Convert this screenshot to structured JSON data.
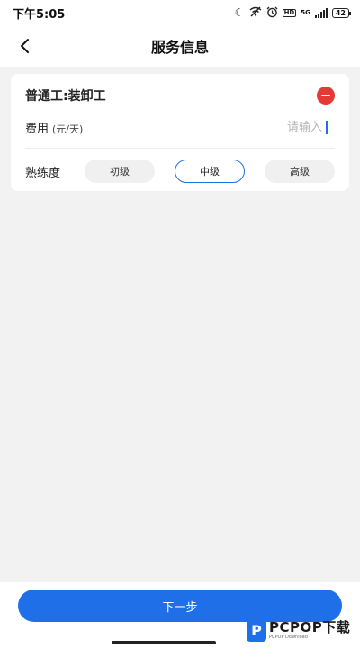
{
  "status_bar": {
    "time": "下午5:05",
    "network": "5G",
    "battery": "42",
    "icons": [
      "moon-icon",
      "wifi-off-icon",
      "alarm-icon",
      "hd-icon",
      "signal-icon",
      "battery-icon"
    ]
  },
  "nav": {
    "title": "服务信息",
    "back_icon": "chevron-left-icon"
  },
  "service": {
    "name": "普通工:装卸工",
    "fee_label": "费用",
    "fee_unit": "(元/天)",
    "fee_value": "",
    "fee_placeholder": "请输入",
    "level_label": "熟练度",
    "levels": [
      "初级",
      "中级",
      "高级"
    ],
    "selected_level": "中级"
  },
  "footer": {
    "next_label": "下一步"
  },
  "watermark": {
    "main": "PCPOP下载",
    "sub": "PCPOP Download",
    "logo": "P"
  },
  "colors": {
    "accent": "#1e6fe8",
    "danger": "#e53935",
    "background": "#f2f2f2"
  }
}
